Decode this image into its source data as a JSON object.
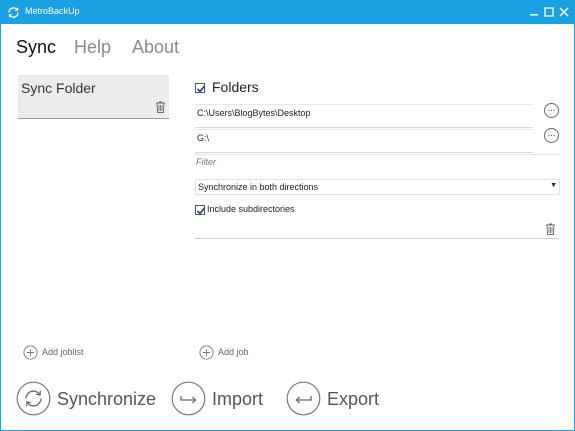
{
  "window": {
    "title": "MetroBackUp",
    "app_icon": "sync-arrows-icon",
    "controls": [
      "minimize-icon",
      "maximize-icon",
      "close-icon"
    ]
  },
  "tabs": [
    {
      "label": "Sync",
      "active": true
    },
    {
      "label": "Help",
      "active": false
    },
    {
      "label": "About",
      "active": false
    }
  ],
  "joblists": [
    {
      "name": "Sync Folder",
      "icon": "trash-icon"
    }
  ],
  "job": {
    "type_label": "Folders",
    "type_checked": true,
    "source_path": "C:\\Users\\BlogBytes\\Desktop",
    "target_path": "G:\\",
    "browse_label": "...",
    "filter_placeholder": "Filter",
    "sync_mode": "Synchronize in both directions",
    "include_subdirs_label": "Include subdirectories",
    "include_subdirs_checked": true
  },
  "actions": {
    "add_joblist": "Add joblist",
    "add_job": "Add job",
    "synchronize": "Synchronize",
    "import": "Import",
    "export": "Export"
  },
  "colors": {
    "accent": "#1ba1e2",
    "selected_bg": "#ececec"
  }
}
